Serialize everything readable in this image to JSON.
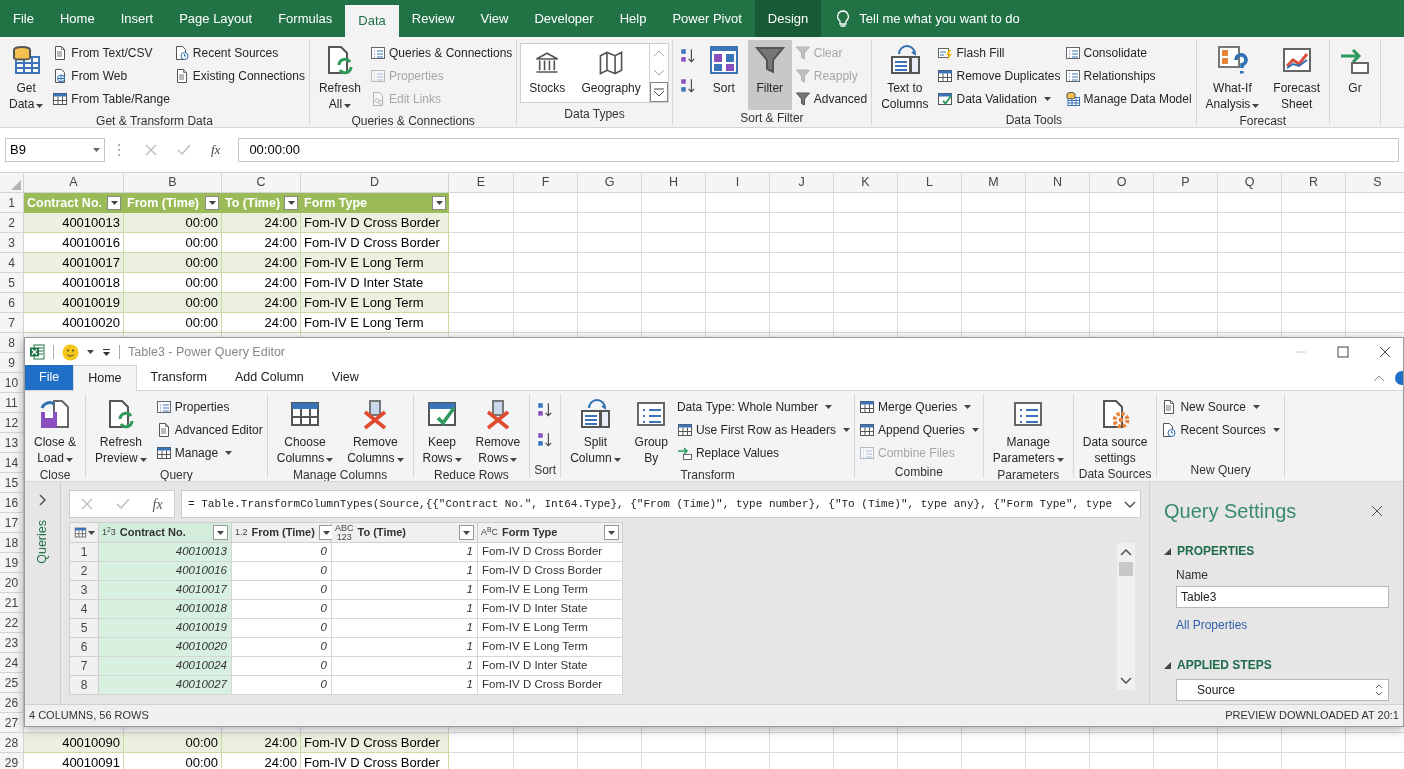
{
  "excel": {
    "tabs": [
      {
        "label": "File",
        "kind": "tab",
        "selected": false
      },
      {
        "label": "Home",
        "kind": "tab",
        "selected": false
      },
      {
        "label": "Insert",
        "kind": "tab",
        "selected": false
      },
      {
        "label": "Page Layout",
        "kind": "tab",
        "selected": false
      },
      {
        "label": "Formulas",
        "kind": "tab",
        "selected": false
      },
      {
        "label": "Data",
        "kind": "tab",
        "selected": true
      },
      {
        "label": "Review",
        "kind": "tab",
        "selected": false
      },
      {
        "label": "View",
        "kind": "tab",
        "selected": false
      },
      {
        "label": "Developer",
        "kind": "tab",
        "selected": false
      },
      {
        "label": "Help",
        "kind": "tab",
        "selected": false
      },
      {
        "label": "Power Pivot",
        "kind": "tab",
        "selected": false
      },
      {
        "label": "Design",
        "kind": "contextual",
        "selected": false
      }
    ],
    "tell_me": "Tell me what you want to do",
    "ribbon": [
      {
        "label": "Get & Transform Data",
        "columns": [
          [
            {
              "kind": "large",
              "label": "Get\nData",
              "dropdown": true,
              "disabled": false
            }
          ],
          [
            {
              "kind": "small",
              "label": "From Text/CSV",
              "disabled": false
            },
            {
              "kind": "small",
              "label": "From Web",
              "disabled": false
            },
            {
              "kind": "small",
              "label": "From Table/Range",
              "disabled": false
            }
          ],
          [
            {
              "kind": "small",
              "label": "Recent Sources",
              "disabled": false
            },
            {
              "kind": "small",
              "label": "Existing Connections",
              "disabled": false
            }
          ]
        ]
      },
      {
        "label": "Queries & Connections",
        "columns": [
          [
            {
              "kind": "large",
              "label": "Refresh\nAll",
              "dropdown": true,
              "disabled": false
            }
          ],
          [
            {
              "kind": "small",
              "label": "Queries & Connections",
              "disabled": false
            },
            {
              "kind": "small",
              "label": "Properties",
              "disabled": true
            },
            {
              "kind": "small",
              "label": "Edit Links",
              "disabled": true
            }
          ]
        ]
      },
      {
        "label": "Data Types",
        "columns": [
          [
            {
              "kind": "gallery",
              "items": [
                "Stocks",
                "Geography"
              ]
            }
          ]
        ]
      },
      {
        "label": "Sort & Filter",
        "columns": [
          [
            {
              "kind": "icon",
              "disabled": false
            },
            {
              "kind": "icon",
              "disabled": false
            }
          ],
          [
            {
              "kind": "large",
              "label": "Sort",
              "disabled": false
            }
          ],
          [
            {
              "kind": "large",
              "label": "Filter",
              "disabled": false,
              "pressed": true
            }
          ],
          [
            {
              "kind": "small",
              "label": "Clear",
              "disabled": true
            },
            {
              "kind": "small",
              "label": "Reapply",
              "disabled": true
            },
            {
              "kind": "small",
              "label": "Advanced",
              "disabled": false
            }
          ]
        ]
      },
      {
        "label": "Data Tools",
        "columns": [
          [
            {
              "kind": "large",
              "label": "Text to\nColumns",
              "disabled": false
            }
          ],
          [
            {
              "kind": "small",
              "label": "Flash Fill",
              "disabled": false
            },
            {
              "kind": "small",
              "label": "Remove Duplicates",
              "disabled": false
            },
            {
              "kind": "small",
              "label": "Data Validation",
              "dropdown": true,
              "disabled": false
            }
          ],
          [
            {
              "kind": "small",
              "label": "Consolidate",
              "disabled": false
            },
            {
              "kind": "small",
              "label": "Relationships",
              "disabled": false
            },
            {
              "kind": "small",
              "label": "Manage Data Model",
              "disabled": false
            }
          ]
        ]
      },
      {
        "label": "Forecast",
        "columns": [
          [
            {
              "kind": "large",
              "label": "What-If\nAnalysis",
              "dropdown": true,
              "disabled": false
            }
          ],
          [
            {
              "kind": "large",
              "label": "Forecast\nSheet",
              "disabled": false
            }
          ]
        ]
      },
      {
        "columns": [
          [
            {
              "kind": "large",
              "label": "Gr",
              "disabled": false
            }
          ]
        ]
      }
    ],
    "name_box": "B9",
    "function_button": "fx",
    "formula": "00:00:00",
    "columns": [
      "A",
      "B",
      "C",
      "D",
      "E",
      "F",
      "G",
      "H",
      "I",
      "J",
      "K",
      "L",
      "M",
      "N",
      "O",
      "P",
      "Q",
      "R",
      "S"
    ],
    "header_row": {
      "row": "1",
      "cells": [
        "Contract No.",
        "From (Time)",
        "To (Time)",
        "Form Type"
      ]
    },
    "rows_top": [
      {
        "row": "2",
        "banded": true,
        "cells": [
          "40010013",
          "00:00",
          "24:00",
          "Fom-IV D Cross Border"
        ]
      },
      {
        "row": "3",
        "banded": false,
        "cells": [
          "40010016",
          "00:00",
          "24:00",
          "Fom-IV D Cross Border"
        ]
      },
      {
        "row": "4",
        "banded": true,
        "cells": [
          "40010017",
          "00:00",
          "24:00",
          "Fom-IV E Long Term"
        ]
      },
      {
        "row": "5",
        "banded": false,
        "cells": [
          "40010018",
          "00:00",
          "24:00",
          "Fom-IV D Inter State"
        ]
      },
      {
        "row": "6",
        "banded": true,
        "cells": [
          "40010019",
          "00:00",
          "24:00",
          "Fom-IV E Long Term"
        ]
      },
      {
        "row": "7",
        "banded": false,
        "cells": [
          "40010020",
          "00:00",
          "24:00",
          "Fom-IV E Long Term"
        ]
      }
    ],
    "covered_row_numbers": [
      "8",
      "9",
      "10",
      "11",
      "12",
      "13",
      "14",
      "15",
      "16",
      "17",
      "18",
      "19",
      "20",
      "21",
      "22",
      "23",
      "24",
      "25",
      "26",
      "27"
    ],
    "rows_bottom": [
      {
        "row": "28",
        "banded": true,
        "cells": [
          "40010090",
          "00:00",
          "24:00",
          "Fom-IV D Cross Border"
        ]
      },
      {
        "row": "29",
        "banded": false,
        "cells": [
          "40010091",
          "00:00",
          "24:00",
          "Fom-IV D Cross Border"
        ]
      }
    ]
  },
  "power_query": {
    "title": "Table3 - Power Query Editor",
    "tabs": [
      {
        "label": "File",
        "kind": "file",
        "selected": false
      },
      {
        "label": "Home",
        "kind": "tab",
        "selected": true
      },
      {
        "label": "Transform",
        "kind": "tab",
        "selected": false
      },
      {
        "label": "Add Column",
        "kind": "tab",
        "selected": false
      },
      {
        "label": "View",
        "kind": "tab",
        "selected": false
      }
    ],
    "ribbon": [
      {
        "label": "Close",
        "columns": [
          [
            {
              "kind": "large",
              "label": "Close &\nLoad",
              "dropdown": true,
              "disabled": false
            }
          ]
        ]
      },
      {
        "label": "Query",
        "columns": [
          [
            {
              "kind": "large",
              "label": "Refresh\nPreview",
              "dropdown": true,
              "disabled": false
            }
          ],
          [
            {
              "kind": "small",
              "label": "Properties",
              "disabled": false
            },
            {
              "kind": "small",
              "label": "Advanced Editor",
              "disabled": false
            },
            {
              "kind": "small",
              "label": "Manage",
              "dropdown": true,
              "disabled": false
            }
          ]
        ]
      },
      {
        "label": "Manage Columns",
        "columns": [
          [
            {
              "kind": "large",
              "label": "Choose\nColumns",
              "dropdown": true,
              "disabled": false
            }
          ],
          [
            {
              "kind": "large",
              "label": "Remove\nColumns",
              "dropdown": true,
              "disabled": false
            }
          ]
        ]
      },
      {
        "label": "Reduce Rows",
        "columns": [
          [
            {
              "kind": "large",
              "label": "Keep\nRows",
              "dropdown": true,
              "disabled": false
            }
          ],
          [
            {
              "kind": "large",
              "label": "Remove\nRows",
              "dropdown": true,
              "disabled": false
            }
          ]
        ]
      },
      {
        "label": "Sort",
        "columns": [
          [
            {
              "kind": "icon",
              "disabled": false
            },
            {
              "kind": "icon",
              "disabled": false
            }
          ]
        ]
      },
      {
        "label": "Transform",
        "columns": [
          [
            {
              "kind": "large",
              "label": "Split\nColumn",
              "dropdown": true,
              "disabled": false
            }
          ],
          [
            {
              "kind": "large",
              "label": "Group\nBy",
              "disabled": false
            }
          ],
          [
            {
              "kind": "small",
              "label": "Data Type: Whole Number",
              "dropdown": true,
              "disabled": false
            },
            {
              "kind": "small",
              "label": "Use First Row as Headers",
              "dropdown": true,
              "disabled": false
            },
            {
              "kind": "small",
              "label": "Replace Values",
              "disabled": false
            }
          ]
        ]
      },
      {
        "label": "Combine",
        "columns": [
          [
            {
              "kind": "small",
              "label": "Merge Queries",
              "dropdown": true,
              "disabled": false
            },
            {
              "kind": "small",
              "label": "Append Queries",
              "dropdown": true,
              "disabled": false
            },
            {
              "kind": "small",
              "label": "Combine Files",
              "disabled": true
            }
          ]
        ]
      },
      {
        "label": "Parameters",
        "columns": [
          [
            {
              "kind": "large",
              "label": "Manage\nParameters",
              "dropdown": true,
              "disabled": false
            }
          ]
        ]
      },
      {
        "label": "Data Sources",
        "columns": [
          [
            {
              "kind": "large",
              "label": "Data source\nsettings",
              "disabled": false
            }
          ]
        ]
      },
      {
        "label": "New Query",
        "columns": [
          [
            {
              "kind": "small",
              "label": "New Source",
              "dropdown": true,
              "disabled": false
            },
            {
              "kind": "small",
              "label": "Recent Sources",
              "dropdown": true,
              "disabled": false
            }
          ]
        ]
      }
    ],
    "queries_label": "Queries",
    "function_button": "fx",
    "formula": "= Table.TransformColumnTypes(Source,{{\"Contract No.\", Int64.Type}, {\"From (Time)\", type number}, {\"To (Time)\", type any}, {\"Form Type\", type",
    "grid": {
      "columns": [
        {
          "type": "1$^{2}$3",
          "name": "Contract No.",
          "selected": true
        },
        {
          "type": "1.2",
          "name": "From (Time)",
          "selected": false
        },
        {
          "type": "ABC\n123",
          "name": "To (Time)",
          "selected": false
        },
        {
          "type": "A$^{B}$C",
          "name": "Form Type",
          "selected": false
        }
      ],
      "rows": [
        {
          "index": "1",
          "cells": [
            "40010013",
            "0",
            "1",
            "Fom-IV D Cross Border"
          ]
        },
        {
          "index": "2",
          "cells": [
            "40010016",
            "0",
            "1",
            "Fom-IV D Cross Border"
          ]
        },
        {
          "index": "3",
          "cells": [
            "40010017",
            "0",
            "1",
            "Fom-IV E Long Term"
          ]
        },
        {
          "index": "4",
          "cells": [
            "40010018",
            "0",
            "1",
            "Fom-IV D Inter State"
          ]
        },
        {
          "index": "5",
          "cells": [
            "40010019",
            "0",
            "1",
            "Fom-IV E Long Term"
          ]
        },
        {
          "index": "6",
          "cells": [
            "40010020",
            "0",
            "1",
            "Fom-IV E Long Term"
          ]
        },
        {
          "index": "7",
          "cells": [
            "40010024",
            "0",
            "1",
            "Fom-IV D Inter State"
          ]
        },
        {
          "index": "8",
          "cells": [
            "40010027",
            "0",
            "1",
            "Fom-IV D Cross Border"
          ]
        }
      ]
    },
    "settings": {
      "title": "Query Settings",
      "properties_heading": "PROPERTIES",
      "name_label": "Name",
      "name_value": "Table3",
      "all_properties": "All Properties",
      "steps_heading": "APPLIED STEPS",
      "steps": [
        "Source"
      ]
    },
    "status_left": "4 COLUMNS, 56 ROWS",
    "status_right": "PREVIEW DOWNLOADED AT 20:1"
  }
}
